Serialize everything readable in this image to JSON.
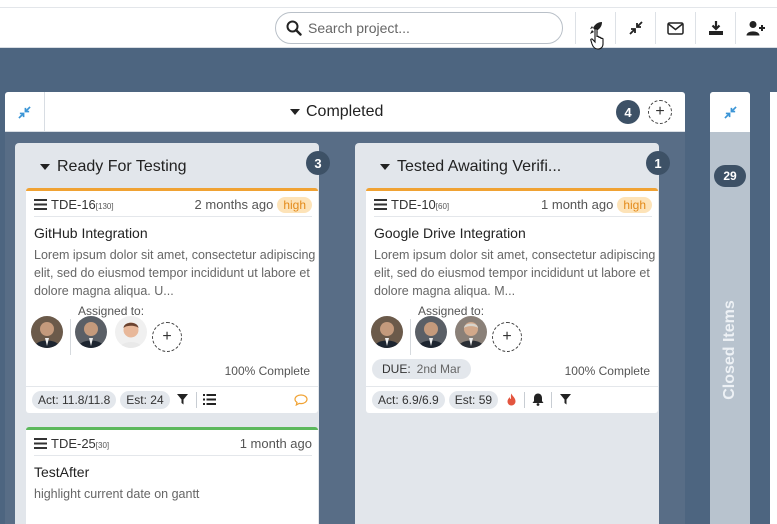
{
  "search": {
    "placeholder": "Search project..."
  },
  "toolbar": {
    "icons": [
      "rocket-icon",
      "collapse-icon",
      "envelope-icon",
      "download-icon",
      "add-user-icon"
    ]
  },
  "group": {
    "title": "Completed",
    "count": "4"
  },
  "columns": [
    {
      "title": "Ready For Testing",
      "count": "3",
      "cards": [
        {
          "id": "TDE-16",
          "points": "[130]",
          "ago": "2 months ago",
          "priority": "high",
          "title": "GitHub Integration",
          "desc": "Lorem ipsum dolor sit amet, consectetur adipiscing elit, sed do eiusmod tempor incididunt ut labore et dolore magna aliqua. U...",
          "assigned_label": "Assigned to:",
          "complete": "100% Complete",
          "actual": "Act: 11.8/11.8",
          "estimate": "Est: 24"
        },
        {
          "id": "TDE-25",
          "points": "[30]",
          "ago": "1 month ago",
          "title": "TestAfter",
          "desc": "highlight current date on gantt"
        }
      ]
    },
    {
      "title": "Tested Awaiting Verifi...",
      "count": "1",
      "cards": [
        {
          "id": "TDE-10",
          "points": "[60]",
          "ago": "1 month ago",
          "priority": "high",
          "title": "Google Drive Integration",
          "desc": "Lorem ipsum dolor sit amet, consectetur adipiscing elit, sed do eiusmod tempor incididunt ut labore et dolore magna aliqua. M...",
          "assigned_label": "Assigned to:",
          "due_label": "DUE:",
          "due_date": "2nd Mar",
          "complete": "100% Complete",
          "actual": "Act: 6.9/6.9",
          "estimate": "Est: 59"
        }
      ]
    }
  ],
  "closed": {
    "count": "29",
    "label": "Closed Items"
  },
  "colors": {
    "board_bg": "#4d6580",
    "priority_high_bg": "#fde3b8",
    "priority_high_text": "#e38a1a",
    "card_orange": "#f0a233",
    "card_green": "#5cb85c",
    "badge": "#3d5166"
  }
}
